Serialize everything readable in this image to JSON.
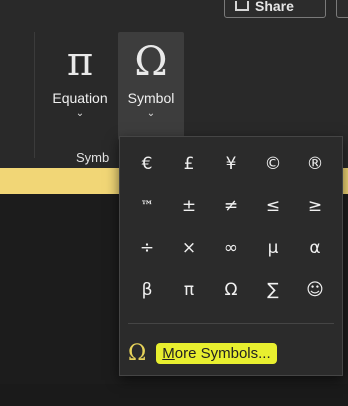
{
  "toolbar": {
    "share_label": "Share"
  },
  "ribbon": {
    "equation": {
      "glyph": "π",
      "label": "Equation",
      "caret": "⌄"
    },
    "symbol": {
      "glyph": "Ω",
      "label": "Symbol",
      "caret": "⌄"
    },
    "group_label": "Symb"
  },
  "symbols_menu": {
    "symbols": [
      "€",
      "£",
      "¥",
      "©",
      "®",
      "™",
      "±",
      "≠",
      "≤",
      "≥",
      "÷",
      "×",
      "∞",
      "µ",
      "α",
      "β",
      "π",
      "Ω",
      "∑",
      "☺"
    ],
    "more_icon": "Ω",
    "more_label_mnemonic": "M",
    "more_label_rest": "ore Symbols..."
  },
  "colors": {
    "highlight": "#e8ef2f",
    "yellow_band": "#f1d676"
  }
}
